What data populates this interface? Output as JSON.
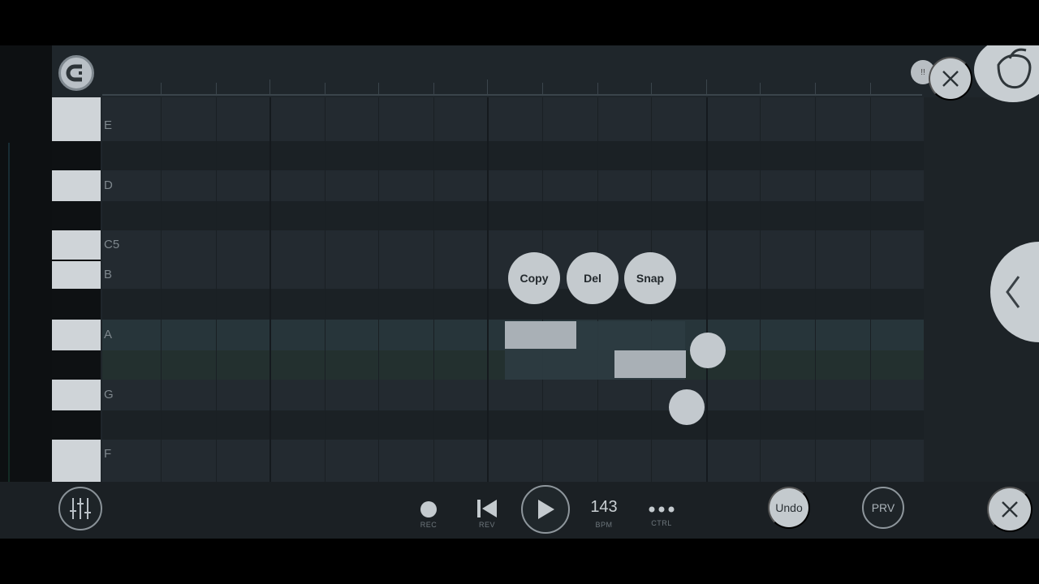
{
  "piano_roll": {
    "note_labels": [
      "E",
      "D",
      "C5",
      "B",
      "A",
      "G",
      "F"
    ]
  },
  "context_menu": {
    "copy_label": "Copy",
    "del_label": "Del",
    "snap_label": "Snap"
  },
  "transport": {
    "rec_label": "REC",
    "rev_label": "REV",
    "bpm_value": "143",
    "bpm_label": "BPM",
    "ctrl_label": "CTRL"
  },
  "actions": {
    "undo_label": "Undo",
    "prv_label": "PRV",
    "mini_tag": "!!"
  },
  "colors": {
    "background": "#1f262b",
    "button": "#c4cace",
    "selected_row": "#27353a"
  }
}
